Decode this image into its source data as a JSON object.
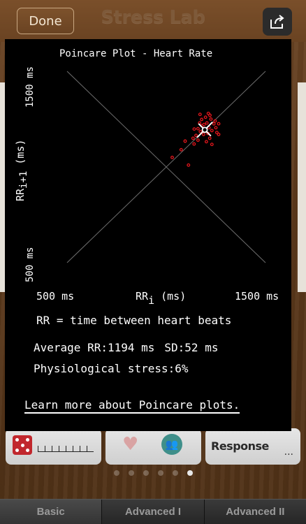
{
  "nav": {
    "done_label": "Done",
    "title": "Stress Lab",
    "share_icon": "share-icon"
  },
  "poincare": {
    "title": "Poincare Plot - Heart Rate",
    "y_tick_top": "1500 ms",
    "y_tick_bottom": "500 ms",
    "y_label_main": "RR",
    "y_label_sub": "i+1",
    "y_label_unit": " (ms)",
    "x_tick_left": "500 ms",
    "x_tick_right": "1500 ms",
    "x_label_main": "RR",
    "x_label_sub": "i",
    "x_label_unit": " (ms)",
    "note": "RR = time between heart beats",
    "average_label": "Average RR:1194 ms",
    "sd_label": "SD:52 ms",
    "stress_label": "Physiological stress:6%",
    "learn_more": "Learn more about Poincare plots.",
    "point_color": "#e0161c",
    "axis_line_color": "#6e6e6e"
  },
  "chart_data": {
    "type": "scatter",
    "title": "Poincare Plot - Heart Rate",
    "xlabel": "RRi (ms)",
    "ylabel": "RRi+1 (ms)",
    "xlim": [
      500,
      1500
    ],
    "ylim": [
      500,
      1500
    ],
    "mean_point": [
      1194,
      1194
    ],
    "series": [
      {
        "points": [
          [
            1194,
            1194
          ],
          [
            1180,
            1215
          ],
          [
            1205,
            1230
          ],
          [
            1215,
            1205
          ],
          [
            1172,
            1185
          ],
          [
            1160,
            1200
          ],
          [
            1225,
            1250
          ],
          [
            1240,
            1225
          ],
          [
            1230,
            1190
          ],
          [
            1188,
            1170
          ],
          [
            1168,
            1230
          ],
          [
            1150,
            1165
          ],
          [
            1210,
            1175
          ],
          [
            1250,
            1205
          ],
          [
            1246,
            1240
          ],
          [
            1198,
            1260
          ],
          [
            1178,
            1248
          ],
          [
            1141,
            1198
          ],
          [
            1219,
            1150
          ],
          [
            1160,
            1140
          ],
          [
            1230,
            1118
          ],
          [
            1255,
            1180
          ],
          [
            1202,
            1132
          ],
          [
            1140,
            1120
          ],
          [
            1190,
            1222
          ],
          [
            1170,
            1275
          ],
          [
            1212,
            1280
          ],
          [
            1264,
            1226
          ],
          [
            1135,
            1150
          ],
          [
            1095,
            1135
          ],
          [
            1075,
            1090
          ],
          [
            1030,
            1050
          ],
          [
            1112,
            1010
          ],
          [
            1264,
            1170
          ],
          [
            1220,
            1270
          ]
        ]
      }
    ]
  },
  "background": {
    "card_response_label": "Response",
    "card_ellipsis": "...",
    "heart_icon": "heart-icon",
    "people_icon": "people-icon",
    "dice_icon": "dice-icon"
  },
  "page_indicator": {
    "count": 6,
    "active": 5
  },
  "tabs": [
    "Basic",
    "Advanced I",
    "Advanced II"
  ]
}
